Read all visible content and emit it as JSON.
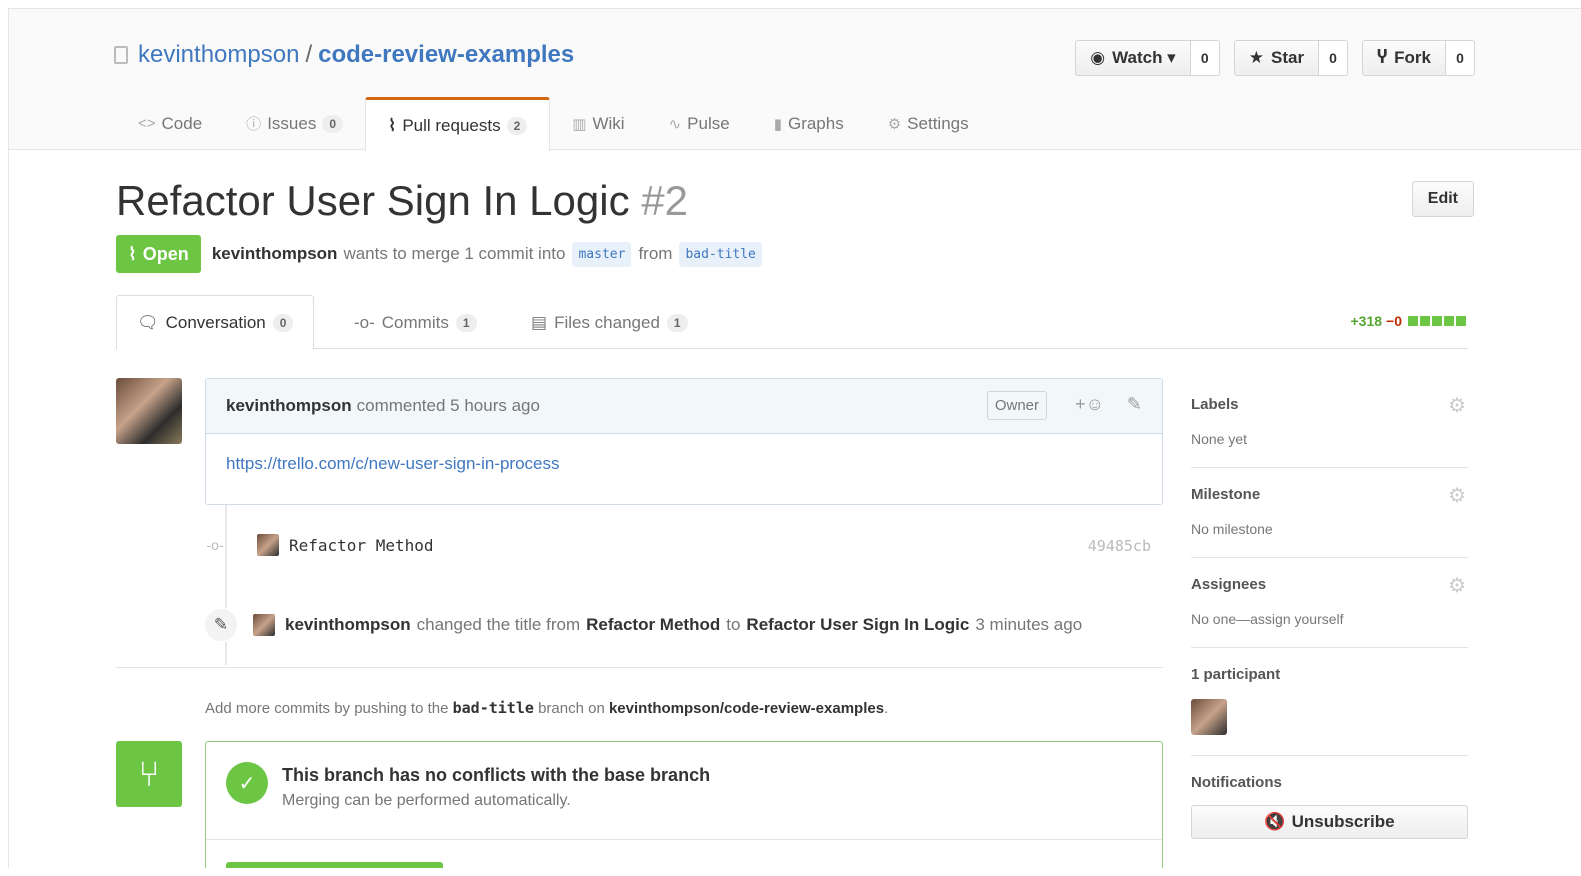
{
  "repo": {
    "owner": "kevinthompson",
    "separator": "/",
    "name": "code-review-examples"
  },
  "actions": {
    "watch": {
      "label": "Watch ▾",
      "count": "0"
    },
    "star": {
      "label": "Star",
      "count": "0"
    },
    "fork": {
      "label": "Fork",
      "count": "0"
    }
  },
  "nav": {
    "code": "Code",
    "issues": "Issues",
    "issues_count": "0",
    "pulls": "Pull requests",
    "pulls_count": "2",
    "wiki": "Wiki",
    "pulse": "Pulse",
    "graphs": "Graphs",
    "settings": "Settings"
  },
  "pr": {
    "title": "Refactor User Sign In Logic",
    "number": "#2",
    "edit_label": "Edit",
    "state": "Open",
    "author": "kevinthompson",
    "merge_text": "wants to merge 1 commit into",
    "base": "master",
    "from_text": "from",
    "head": "bad-title"
  },
  "tabs": {
    "conversation": "Conversation",
    "conversation_count": "0",
    "commits": "Commits",
    "commits_count": "1",
    "files": "Files changed",
    "files_count": "1"
  },
  "diffstat": {
    "additions": "+318",
    "deletions": "−0"
  },
  "comment": {
    "author": "kevinthompson",
    "action": "commented 5 hours ago",
    "badge": "Owner",
    "link": "https://trello.com/c/new-user-sign-in-process"
  },
  "commit_event": {
    "message": "Refactor Method",
    "sha": "49485cb"
  },
  "rename_event": {
    "author": "kevinthompson",
    "text1": "changed the title from",
    "old_title": "Refactor Method",
    "text2": "to",
    "new_title": "Refactor User Sign In Logic",
    "time": "3 minutes ago"
  },
  "push_hint": {
    "text1": "Add more commits by pushing to the",
    "branch": "bad-title",
    "text2": "branch on",
    "repo": "kevinthompson/code-review-examples",
    "text3": "."
  },
  "merge": {
    "title": "This branch has no conflicts with the base branch",
    "subtitle": "Merging can be performed automatically."
  },
  "sidebar": {
    "labels_head": "Labels",
    "labels_val": "None yet",
    "milestone_head": "Milestone",
    "milestone_val": "No milestone",
    "assignees_head": "Assignees",
    "assignees_val": "No one—assign yourself",
    "participants_head": "1 participant",
    "notifications_head": "Notifications",
    "unsubscribe": "Unsubscribe"
  },
  "colors": {
    "accent": "#4078c0",
    "open_green": "#6cc644",
    "nav_selected": "#d26911"
  }
}
